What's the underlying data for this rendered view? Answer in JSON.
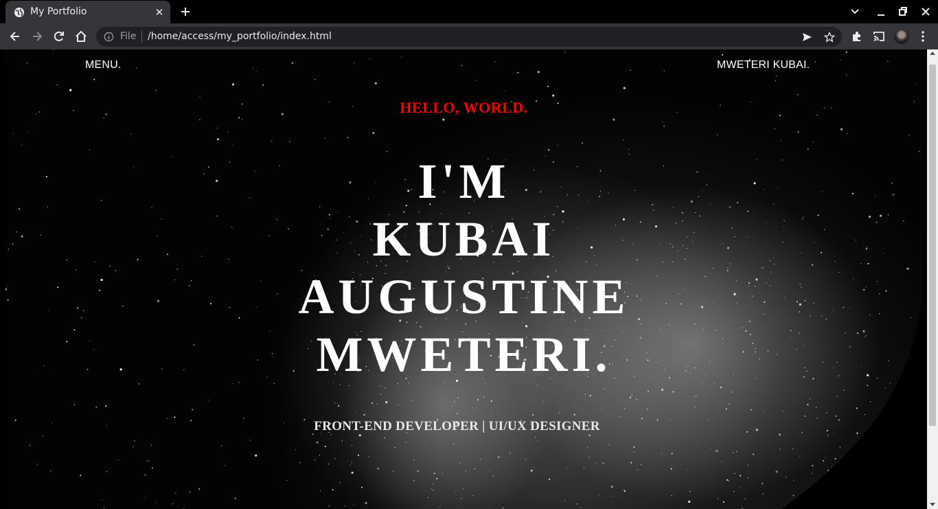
{
  "browser": {
    "tab_title": "My Portfolio",
    "omnibox_scheme": "File",
    "omnibox_url": "/home/access/my_portfolio/index.html"
  },
  "icons": {
    "favicon": "globe-icon",
    "tab_close": "close-icon",
    "new_tab": "plus-icon",
    "tab_search": "chevron-down-icon",
    "minimize": "minimize-icon",
    "restore": "restore-icon",
    "close_window": "close-icon",
    "back": "arrow-left-icon",
    "forward": "arrow-right-icon",
    "reload": "reload-icon",
    "home": "home-icon",
    "site_info": "info-icon",
    "send": "send-icon",
    "bookmark": "star-icon",
    "extensions": "puzzle-icon",
    "cast": "cast-icon",
    "menu": "kebab-icon"
  },
  "site": {
    "nav_menu": "MENU.",
    "nav_brand": "MWETERI KUBAI.",
    "greeting": "HELLO, WORLD.",
    "hero_lines": [
      "I'M",
      "KUBAI",
      "AUGUSTINE",
      "MWETERI."
    ],
    "subtitle": "FRONT-END DEVELOPER | UI/UX DESIGNER"
  },
  "colors": {
    "greeting": "#ff0000",
    "hero_text": "#ffffff",
    "chrome_bg": "#35363a",
    "tabstrip_bg": "#000000"
  }
}
